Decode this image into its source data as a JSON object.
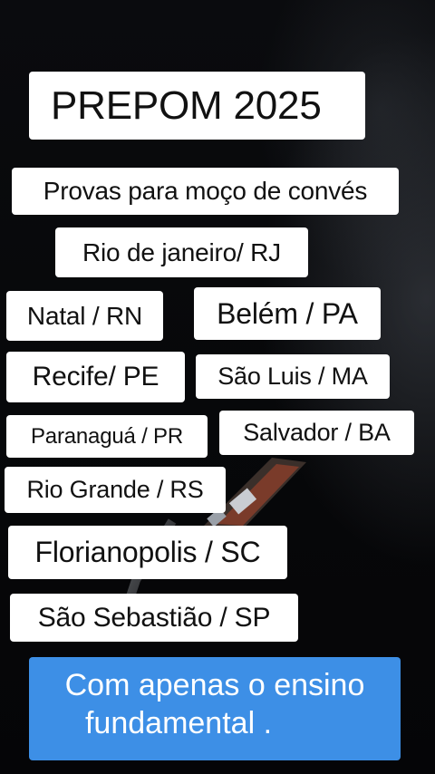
{
  "title": "PREPOM 2025",
  "subtitle": "Provas para moço de convés",
  "locations": [
    "Rio de janeiro/ RJ",
    "Natal / RN",
    "Belém / PA",
    "Recife/ PE",
    "São Luis / MA",
    "Paranaguá / PR",
    "Salvador / BA",
    "Rio Grande / RS",
    "Florianopolis / SC",
    "São Sebastião / SP"
  ],
  "banner": {
    "line1": "Com apenas o ensino",
    "line2": "fundamental ."
  },
  "colors": {
    "background": "#060608",
    "label_bg": "#ffffff",
    "label_text": "#111111",
    "banner_bg": "#3d8fe6",
    "banner_text": "#ffffff"
  }
}
